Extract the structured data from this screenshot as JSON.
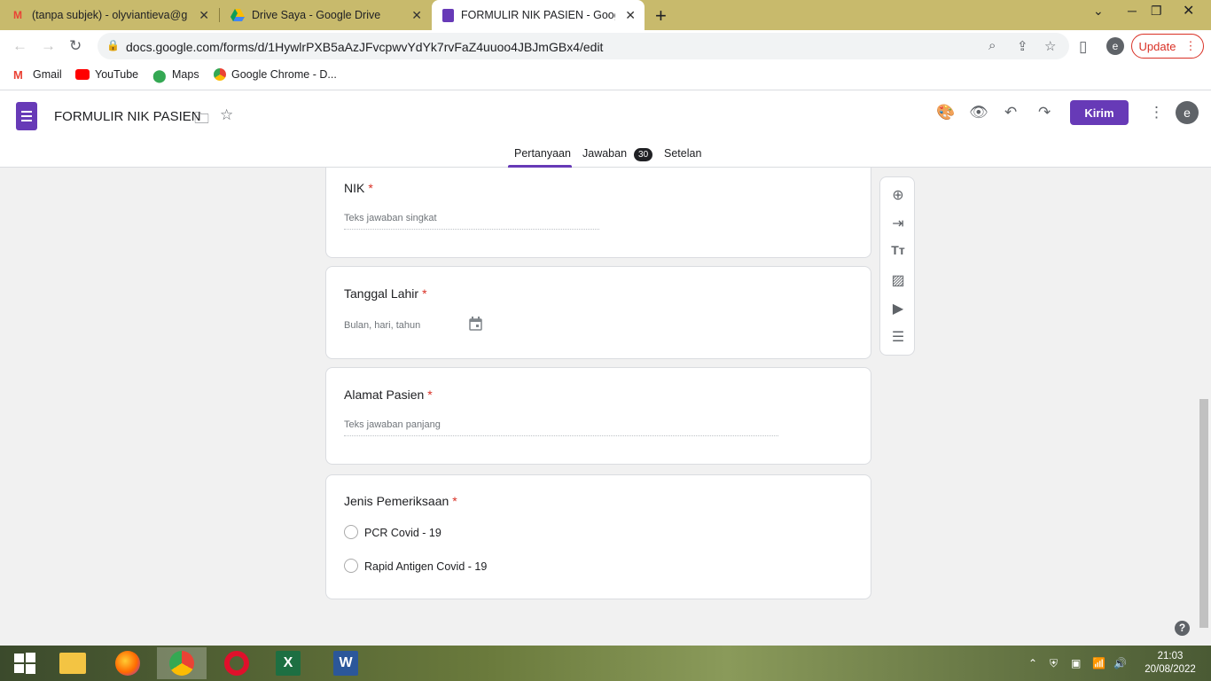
{
  "browser": {
    "tabs": [
      {
        "title": "(tanpa subjek) - olyviantieva@gn",
        "icon": "gmail-icon"
      },
      {
        "title": "Drive Saya - Google Drive",
        "icon": "drive-icon"
      },
      {
        "title": "FORMULIR NIK PASIEN - Google",
        "icon": "forms-icon"
      }
    ],
    "url": "docs.google.com/forms/d/1HywlrPXB5aAzJFvcpwvYdYk7rvFaZ4uuoo4JBJmGBx4/edit",
    "update_label": "Update",
    "profile_initial": "e",
    "bookmarks": [
      "Gmail",
      "YouTube",
      "Maps",
      "Google Chrome - D..."
    ]
  },
  "forms": {
    "title": "FORMULIR NIK PASIEN",
    "send_label": "Kirim",
    "avatar_initial": "e",
    "tabs": [
      "Pertanyaan",
      "Jawaban",
      "Setelan"
    ],
    "responses_count": "30",
    "questions": [
      {
        "title": "NIK",
        "required": "*",
        "hint": "Teks jawaban singkat"
      },
      {
        "title": "Tanggal Lahir",
        "required": "*",
        "hint": "Bulan, hari, tahun"
      },
      {
        "title": "Alamat Pasien",
        "required": "*",
        "hint": "Teks jawaban panjang"
      },
      {
        "title": "Jenis Pemeriksaan",
        "required": "*",
        "options": [
          "PCR Covid - 19",
          "Rapid Antigen Covid - 19"
        ]
      }
    ]
  },
  "taskbar": {
    "time": "21:03",
    "date": "20/08/2022"
  },
  "colors": {
    "accent": "#673ab7",
    "required": "#d93025",
    "tabstrip": "#c8ba6c"
  }
}
